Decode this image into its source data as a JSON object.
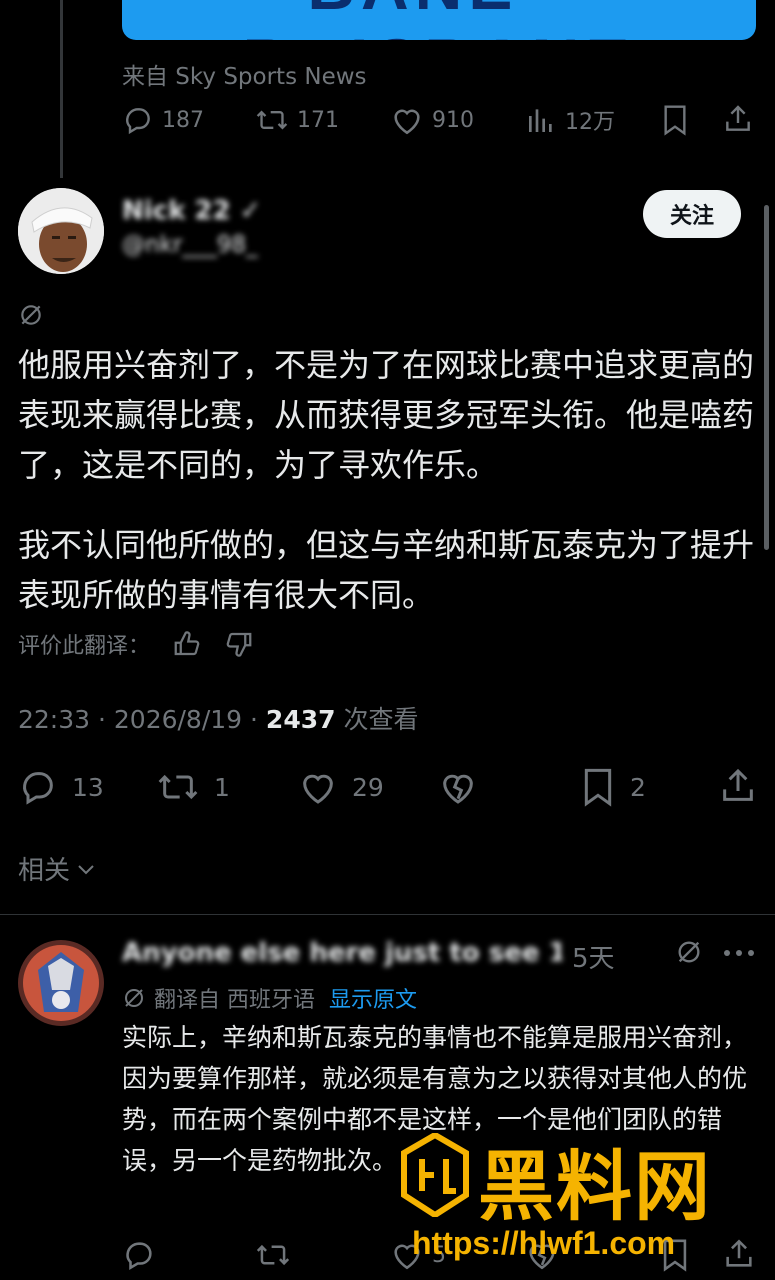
{
  "quoted": {
    "banner_text": "BANE · BRISBANE",
    "source": "来自 Sky Sports News",
    "actions": {
      "replies": "187",
      "reposts": "171",
      "likes": "910",
      "views": "12万"
    }
  },
  "tweet": {
    "author_name": "Nick 22 ✓",
    "author_handle": "@nkr___98_",
    "follow_label": "关注",
    "paragraph1": "他服用兴奋剂了，不是为了在网球比赛中追求更高的表现来赢得比赛，从而获得更多冠军头衔。他是嗑药了，这是不同的，为了寻欢作乐。",
    "paragraph2": "我不认同他所做的，但这与辛纳和斯瓦泰克为了提升表现所做的事情有很大不同。",
    "rate_label": "评价此翻译：",
    "time": "22:33",
    "date": "2026/8/19",
    "view_count": "2437",
    "view_label": "次查看",
    "actions": {
      "replies": "13",
      "reposts": "1",
      "likes": "29",
      "bookmarks": "2"
    }
  },
  "related_label": "相关",
  "reply": {
    "author_blur": "Anyone else here just to see 14",
    "age": "5天",
    "translated_from": "翻译自 西班牙语",
    "show_original": "显示原文",
    "text": "实际上，辛纳和斯瓦泰克的事情也不能算是服用兴奋剂，因为要算作那样，就必须是有意为之以获得对其他人的优势，而在两个案例中都不是这样，一个是他们团队的错误，另一个是药物批次。",
    "actions": {
      "likes": "5"
    }
  },
  "watermark": {
    "brand": "黑料网",
    "url": "https://hlwf1.com"
  },
  "colors": {
    "accent": "#1d9bf0",
    "muted": "#71767b",
    "text": "#e7e9ea",
    "watermark": "#f5b301"
  }
}
